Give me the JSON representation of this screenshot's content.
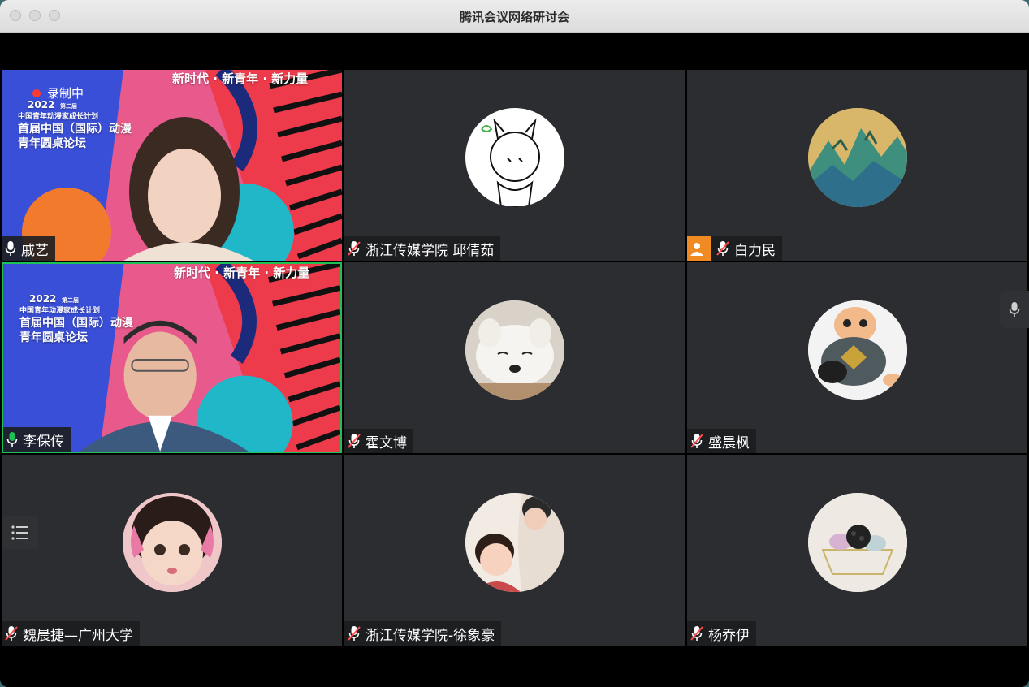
{
  "window": {
    "title": "腾讯会议网络研讨会"
  },
  "poster": {
    "slogan": "新时代 · 新青年 · 新力量",
    "year": "2022",
    "year_suffix": "第二届",
    "program": "中国青年动漫家成长计划",
    "forum_line1": "首届中国（国际）动漫",
    "forum_line2": "青年圆桌论坛"
  },
  "recording": {
    "label": "录制中"
  },
  "participants": [
    {
      "name": "戚艺",
      "mic": "on",
      "type": "video"
    },
    {
      "name": "浙江传媒学院 邱倩茹",
      "mic": "muted",
      "type": "avatar",
      "avatar": "sketch-girl-avatar"
    },
    {
      "name": "白力民",
      "mic": "muted",
      "type": "avatar",
      "avatar": "landscape-painting-avatar",
      "badge": "user-icon"
    },
    {
      "name": "李保传",
      "mic": "speaking",
      "type": "video",
      "active": true
    },
    {
      "name": "霍文博",
      "mic": "muted",
      "type": "avatar",
      "avatar": "white-dog-avatar"
    },
    {
      "name": "盛晨枫",
      "mic": "muted",
      "type": "avatar",
      "avatar": "toy-figure-avatar"
    },
    {
      "name": "魏晨捷—广州大学",
      "mic": "muted",
      "type": "avatar",
      "avatar": "child-photo-avatar"
    },
    {
      "name": "浙江传媒学院-徐象豪",
      "mic": "muted",
      "type": "avatar",
      "avatar": "illustration-couple-avatar"
    },
    {
      "name": "杨乔伊",
      "mic": "muted",
      "type": "avatar",
      "avatar": "berry-drawing-avatar"
    }
  ],
  "colors": {
    "tile_bg": "#2b2d30",
    "active_border": "#1ec254",
    "speaking_mic": "#1ec254",
    "muted_mic": "#ff4d4f",
    "badge": "#f08a23"
  }
}
